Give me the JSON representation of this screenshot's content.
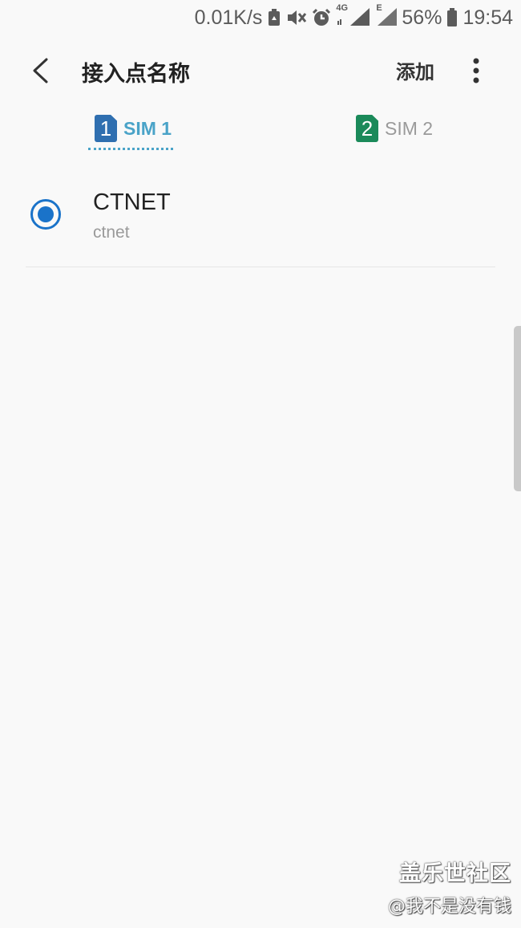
{
  "status_bar": {
    "speed": "0.01K/s",
    "network_type": "4G",
    "network_type_2": "E",
    "battery": "56%",
    "time": "19:54",
    "icons": [
      "battery-saver-icon",
      "mute-icon",
      "alarm-icon",
      "signal-icon",
      "signal-icon-2",
      "battery-icon"
    ]
  },
  "toolbar": {
    "title": "接入点名称",
    "add_label": "添加",
    "back_icon": "back-arrow-icon",
    "more_icon": "more-vert-icon"
  },
  "tabs": [
    {
      "badge": "1",
      "label": "SIM 1",
      "selected": true,
      "color": "#2f6fb0"
    },
    {
      "badge": "2",
      "label": "SIM 2",
      "selected": false,
      "color": "#1b8a5a"
    }
  ],
  "apn_list": [
    {
      "name": "CTNET",
      "apn": "ctnet",
      "selected": true
    }
  ],
  "watermark": {
    "brand": "盖乐世社区",
    "user": "@我不是没有钱"
  },
  "colors": {
    "accent": "#1a73c9",
    "tab_active": "#4aa3c8",
    "background": "#f9f9f9"
  }
}
